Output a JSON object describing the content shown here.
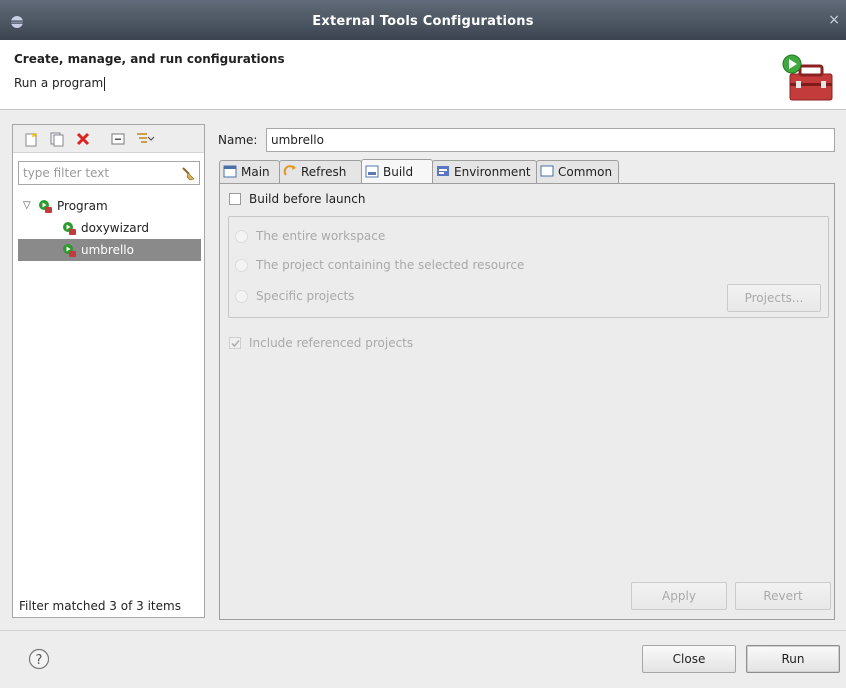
{
  "window": {
    "title": "External Tools Configurations",
    "close_glyph": "×"
  },
  "header": {
    "title": "Create, manage, and run configurations",
    "message": "Run a program"
  },
  "left_panel": {
    "toolbar_icons": [
      "new-configuration-icon",
      "duplicate-icon",
      "delete-icon",
      "collapse-all-icon",
      "filter-icon"
    ],
    "filter_placeholder": "type filter text",
    "tree": [
      {
        "label": "Program",
        "expanded": true,
        "level": 0,
        "selected": false
      },
      {
        "label": "doxywizard",
        "level": 1,
        "selected": false
      },
      {
        "label": "umbrello",
        "level": 1,
        "selected": true
      }
    ],
    "footer": "Filter matched 3 of 3 items"
  },
  "editor": {
    "name_label": "Name:",
    "name_value": "umbrello",
    "tabs": [
      {
        "label": "Main",
        "icon": "main-tab-icon"
      },
      {
        "label": "Refresh",
        "icon": "refresh-icon"
      },
      {
        "label": "Build",
        "icon": "build-icon",
        "active": true
      },
      {
        "label": "Environment",
        "icon": "environment-icon"
      },
      {
        "label": "Common",
        "icon": "common-icon"
      }
    ],
    "build_before_launch": {
      "label": "Build before launch",
      "checked": false
    },
    "scope_options": [
      {
        "label": "The entire workspace",
        "enabled": false
      },
      {
        "label": "The project containing the selected resource",
        "enabled": false
      },
      {
        "label": "Specific projects",
        "enabled": false
      }
    ],
    "projects_button": "Projects...",
    "include_referenced": {
      "label": "Include referenced projects",
      "checked": true,
      "enabled": false
    },
    "apply_button": "Apply",
    "revert_button": "Revert"
  },
  "footer": {
    "help_glyph": "?",
    "close_button": "Close",
    "run_button": "Run"
  }
}
